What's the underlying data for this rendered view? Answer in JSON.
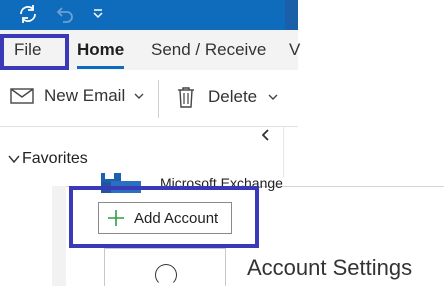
{
  "quick_access": {
    "icons": [
      "sync-icon",
      "undo-icon",
      "customize-dropdown-icon"
    ],
    "colors": {
      "titlebar": "#0f6cbd",
      "icon_active": "#ffffff",
      "icon_disabled": "#6e9fd1"
    }
  },
  "ribbon_tabs": {
    "file": "File",
    "home": "Home",
    "send_receive": "Send / Receive",
    "next_partial": "V"
  },
  "ribbon": {
    "new_email": "New Email",
    "delete": "Delete"
  },
  "folder_pane": {
    "favorites": "Favorites",
    "account_name": "Microsoft Exchange"
  },
  "backstage": {
    "add_account": "Add Account",
    "account_settings": "Account Settings",
    "accent_color": "#2e9e44"
  },
  "annotation_color": "#3a3ab8"
}
